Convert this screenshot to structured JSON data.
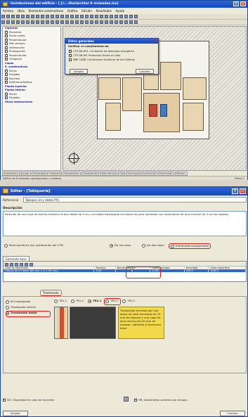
{
  "top_window": {
    "title": "Instalaciones del edificio - [ J:\\...\\Ruriarchiar 8 viviendas.ins]",
    "menu": [
      "Archivo",
      "Obra",
      "Elementos constructivos",
      "Gráfica",
      "Edición",
      "Resultados",
      "Ayuda"
    ],
    "left_panel": [
      {
        "text": "Capturas",
        "section": true
      },
      {
        "text": "Elemento",
        "section": false
      },
      {
        "text": "Punto medio",
        "section": false
      },
      {
        "text": "Perpendicular",
        "section": false
      },
      {
        "text": "Más cercano",
        "section": false
      },
      {
        "text": "Intersección",
        "section": false
      },
      {
        "text": "Prolongación",
        "section": false
      },
      {
        "text": "Perpendicular",
        "section": false
      },
      {
        "text": "Ortogonal",
        "section": false
      },
      {
        "text": "Capas",
        "section": true
      },
      {
        "text": "E. constructivos",
        "section": true
      },
      {
        "text": "Muros",
        "section": false
      },
      {
        "text": "Forjados",
        "section": false
      },
      {
        "text": "Recintos",
        "section": false
      },
      {
        "text": "Edificios próximos",
        "section": false
      },
      {
        "text": "Planta superior",
        "section": true
      },
      {
        "text": "Planta inferior",
        "section": true
      },
      {
        "text": "Muros",
        "section": false
      },
      {
        "text": "Forjados",
        "section": false
      },
      {
        "text": "Otras instalaciones",
        "section": true
      }
    ],
    "bottom_tabs": [
      "Aislamiento",
      "Acondic.",
      "Salubridad",
      "Fontanería",
      "Saneamiento",
      "Climatización",
      "Solar térmica",
      "Gas",
      "Pararrayos",
      "Iluminación",
      "Electricidad",
      "Telecom."
    ],
    "status_left": "Edificio de 8 viviendas, apartamentos y trasteros",
    "status_right": "Planta 1",
    "dialog": {
      "title": "Datos generales",
      "group_label": "Verificar el cumplimiento de:",
      "options": [
        {
          "label": "CTE DB-HE1. Limitación de demanda energética",
          "checked": true
        },
        {
          "label": "CTE DB-HR. Protección frente al ruido",
          "checked": true
        },
        {
          "label": "NBE CA88. Condiciones Acústicas de los Edificios",
          "checked": false
        }
      ],
      "accept": "Aceptar",
      "cancel": "Cancelar"
    }
  },
  "editor": {
    "title": "Editar - [Tabiquería]",
    "reference_label": "Referencia",
    "reference_value": "Tabique LH y doble PYL",
    "description_label": "Descripción",
    "description_text": "Partición de una hoja de ladrillo cerámico hueco doble de 9 cm, con doble trasdosado de placas de yeso laminado con aislamiento de lana mineral de 3 cm de espesor.",
    "wall_types": [
      {
        "label": "Pared genérica (sin justificación del CTE)",
        "selected": false,
        "highlight": false
      },
      {
        "label": "De una hoja",
        "selected": true,
        "highlight": false
      },
      {
        "label": "De dos hojas",
        "selected": false,
        "highlight": false
      },
      {
        "label": "Entramado autoportante",
        "selected": false,
        "highlight": true
      }
    ],
    "base_tab": "Elemento base",
    "columns": [
      "Lista de elementos",
      "Espesor",
      "Banda elástica",
      "Conductividad",
      "Densidad",
      "Calor específico"
    ],
    "row": {
      "name": "Fábrica de LH doble [60 mm < E < 90 mm]",
      "thickness": "9.00",
      "elastic_band": true,
      "conductivity": "0.432",
      "density": "930.0",
      "specific_heat": "1000.0"
    },
    "trasdosado_tab": "Trasdosado",
    "trasdosado_options": [
      {
        "label": "Sin trasdosado",
        "selected": false
      },
      {
        "label": "Trasdosado interior",
        "selected": false
      },
      {
        "label": "Trasdosado doble",
        "selected": true
      }
    ],
    "tr_options": [
      {
        "label": "TR1.1",
        "selected": false
      },
      {
        "label": "TR1.2",
        "selected": false
      },
      {
        "label": "TR2.1",
        "selected": true
      },
      {
        "label": "TR3.1",
        "selected": false
      },
      {
        "label": "TR3.2",
        "selected": false
      }
    ],
    "tr_description": "Trasdosado formado por una placa de yeso laminado de 15 mm de espesor y una capa de lana mineral de 30 mm de espesor, adherido al elemento base.",
    "si_label": "SI1: Seguridad en caso de incendio",
    "hr_label": "HR: Aislamiento acústico por ensayo",
    "accept": "Aceptar",
    "cancel": "Cancelar"
  },
  "colors": {
    "title_blue": "#1a46b8",
    "panel_bg": "#ece9d8",
    "highlight_red": "#d21e1e",
    "description_yellow": "#f2d94a"
  }
}
